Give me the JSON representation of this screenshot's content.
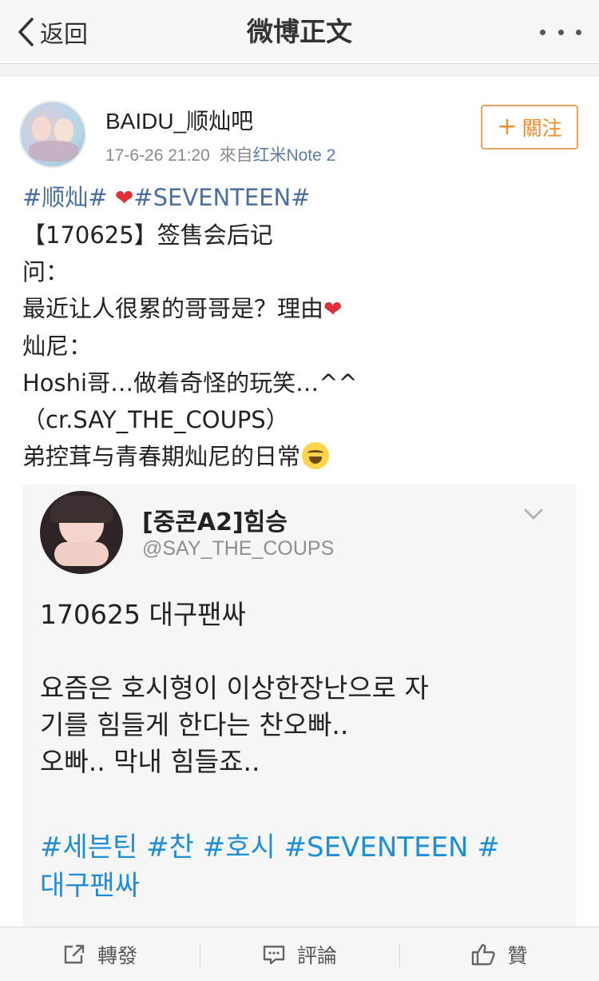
{
  "nav": {
    "back_label": "返回",
    "title": "微博正文"
  },
  "post": {
    "author": "BAIDU_顺灿吧",
    "time": "17-6-26 21:20",
    "source_prefix": "來自",
    "source": "红米Note 2",
    "follow_label": "關注",
    "topic1": "#顺灿#",
    "topic2": "#SEVENTEEN#",
    "lines": [
      "【170625】签售会后记",
      "问：",
      "最近让人很累的哥哥是？理由",
      "灿尼：",
      "Hoshi哥…做着奇怪的玩笑…^^",
      "（cr.SAY_THE_COUPS）",
      "弟控茸与青春期灿尼的日常"
    ]
  },
  "tweet": {
    "name": "[중콘A2]힘승",
    "handle": "@SAY_THE_COUPS",
    "lines": [
      "170625 대구팬싸",
      "",
      "요즘은 호시형이 이상한장난으로 자",
      "기를 힘들게 한다는 찬오빠..",
      "오빠.. 막내 힘들죠.."
    ],
    "tags": [
      "#세븐틴 #찬 #호시 #SEVENTEEN #",
      "대구팬싸"
    ]
  },
  "actions": {
    "repost": "轉發",
    "comment": "評論",
    "like": "贊"
  },
  "colors": {
    "topic": "#4a6fa1",
    "follow": "#ef8c2b",
    "tweet_tag": "#1d8fd8",
    "heart": "#e0303a"
  },
  "icons": {
    "back": "chevron-left-icon",
    "more": "more-dots-icon",
    "heart": "heart-icon",
    "emoji": "laughing-tears-emoji-icon",
    "tweet_menu": "chevron-down-icon",
    "repost": "share-icon",
    "comment": "comment-icon",
    "like": "thumbs-up-icon"
  }
}
